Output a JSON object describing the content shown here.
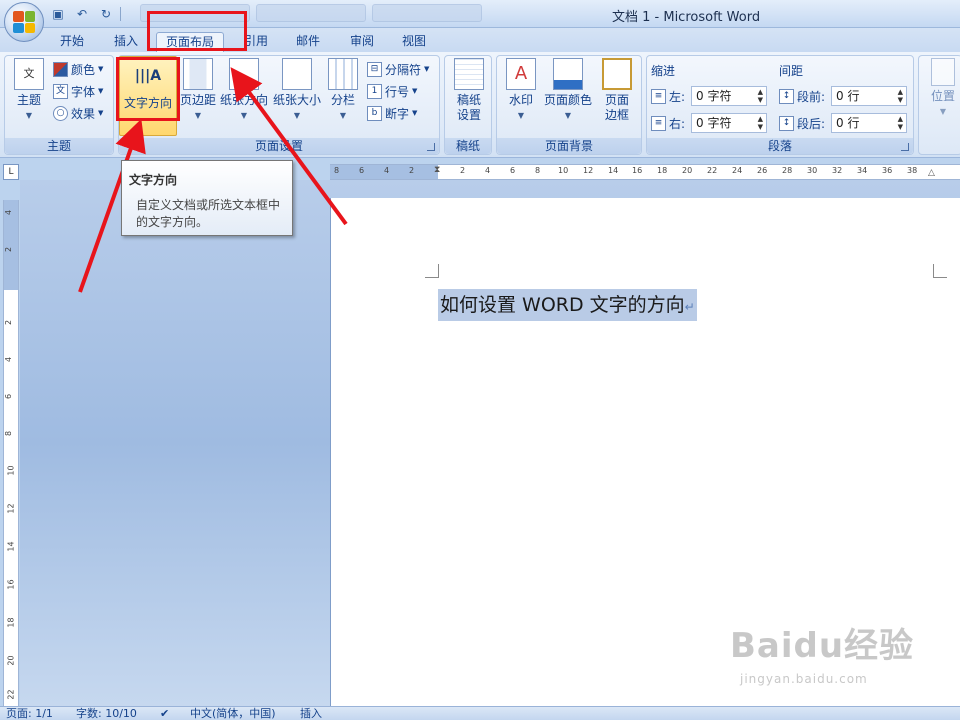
{
  "window": {
    "title": "文档 1 - Microsoft Word"
  },
  "tabs": [
    {
      "label": "开始",
      "active": false
    },
    {
      "label": "插入",
      "active": false
    },
    {
      "label": "页面布局",
      "active": true
    },
    {
      "label": "引用",
      "active": false
    },
    {
      "label": "邮件",
      "active": false
    },
    {
      "label": "审阅",
      "active": false
    },
    {
      "label": "视图",
      "active": false
    }
  ],
  "ribbon": {
    "theme_group": {
      "label": "主题",
      "theme_button": "主题",
      "colors": "颜色",
      "fonts": "字体",
      "effects": "效果"
    },
    "page_setup_group": {
      "label": "页面设置",
      "text_direction": "文字方向",
      "margins": "页边距",
      "orientation": "纸张方向",
      "size": "纸张大小",
      "columns": "分栏",
      "breaks": "分隔符",
      "line_numbers": "行号",
      "hyphenation": "断字"
    },
    "manuscript_group": {
      "label": "稿纸",
      "manuscript_settings_1": "稿纸",
      "manuscript_settings_2": "设置"
    },
    "page_background_group": {
      "label": "页面背景",
      "watermark": "水印",
      "page_color": "页面颜色",
      "page_borders_1": "页面",
      "page_borders_2": "边框"
    },
    "paragraph_group": {
      "label": "段落",
      "indent_heading": "缩进",
      "spacing_heading": "间距",
      "indent_left_label": "左:",
      "indent_left_value": "0 字符",
      "indent_right_label": "右:",
      "indent_right_value": "0 字符",
      "spacing_before_label": "段前:",
      "spacing_before_value": "0 行",
      "spacing_after_label": "段后:",
      "spacing_after_value": "0 行"
    },
    "arrange_group": {
      "position": "位置"
    }
  },
  "tooltip": {
    "title": "文字方向",
    "body": "自定义文档或所选文本框中的文字方向。"
  },
  "ruler": {
    "corner": "L",
    "h_ticks": [
      "8",
      "6",
      "4",
      "2",
      "2",
      "4",
      "6",
      "8",
      "10",
      "12",
      "14",
      "16",
      "18",
      "20",
      "22",
      "24",
      "26",
      "28",
      "30",
      "32",
      "34",
      "36",
      "38"
    ],
    "v_ticks": [
      "4",
      "2",
      "2",
      "4",
      "6",
      "8",
      "10",
      "12",
      "14",
      "16",
      "18",
      "20",
      "22"
    ]
  },
  "document": {
    "text": "如何设置 WORD 文字的方向",
    "pilcrow": "↵"
  },
  "statusbar": {
    "page": "页面: 1/1",
    "words": "字数: 10/10",
    "language": "中文(简体，中国)",
    "insert_mode": "插入"
  },
  "watermark": {
    "line1": "Baidu经验",
    "line2": "jingyan.baidu.com"
  },
  "colors": {
    "annotation_red": "#e8141b",
    "selection": "#b9cbe6"
  }
}
